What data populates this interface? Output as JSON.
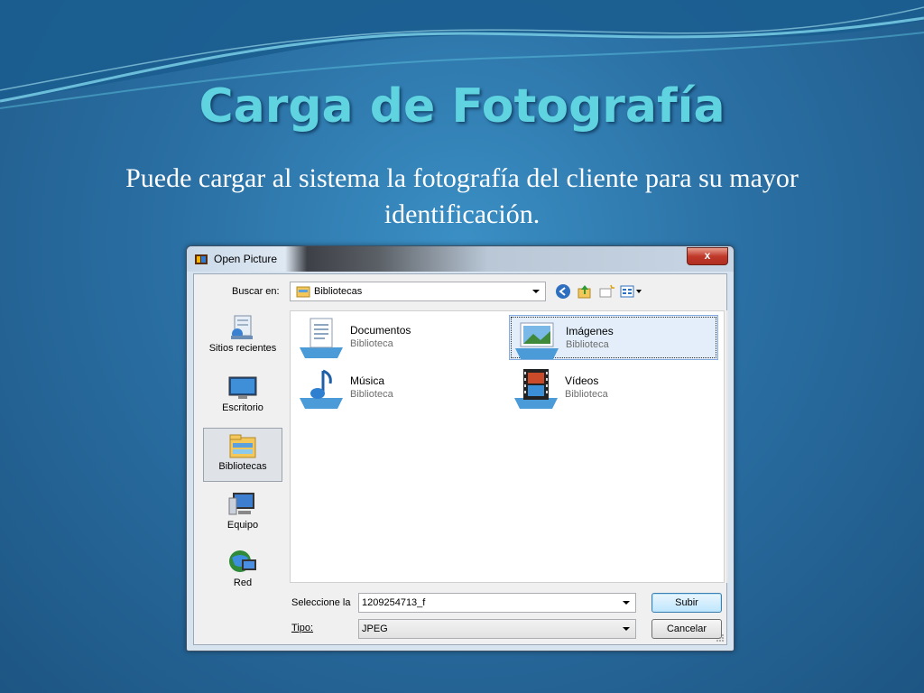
{
  "slide": {
    "title": "Carga de Fotografía",
    "subtitle": "Puede cargar al sistema la fotografía del cliente para su mayor identificación."
  },
  "dialog": {
    "title": "Open Picture",
    "close_label": "x",
    "look_in_label": "Buscar en:",
    "look_in_value": "Bibliotecas",
    "toolbar_icons": [
      "back-icon",
      "up-folder-icon",
      "new-folder-icon",
      "views-menu-icon"
    ],
    "places": [
      {
        "label": "Sitios recientes",
        "icon": "recent-places-icon"
      },
      {
        "label": "Escritorio",
        "icon": "desktop-icon"
      },
      {
        "label": "Bibliotecas",
        "icon": "libraries-icon",
        "selected": true
      },
      {
        "label": "Equipo",
        "icon": "computer-icon"
      },
      {
        "label": "Red",
        "icon": "network-icon"
      }
    ],
    "libraries": [
      {
        "name": "Documentos",
        "kind": "Biblioteca",
        "icon": "documents-library-icon"
      },
      {
        "name": "Imágenes",
        "kind": "Biblioteca",
        "icon": "pictures-library-icon",
        "selected": true
      },
      {
        "name": "Música",
        "kind": "Biblioteca",
        "icon": "music-library-icon"
      },
      {
        "name": "Vídeos",
        "kind": "Biblioteca",
        "icon": "videos-library-icon"
      }
    ],
    "filename_label": "Seleccione la",
    "filename_value": "1209254713_f",
    "type_label": "Tipo:",
    "type_value": "JPEG",
    "open_button": "Subir",
    "cancel_button": "Cancelar"
  },
  "colors": {
    "title": "#5fd3e0",
    "background": "#2a6fa3",
    "close_button": "#c0392b",
    "selection": "#e3eefa"
  }
}
